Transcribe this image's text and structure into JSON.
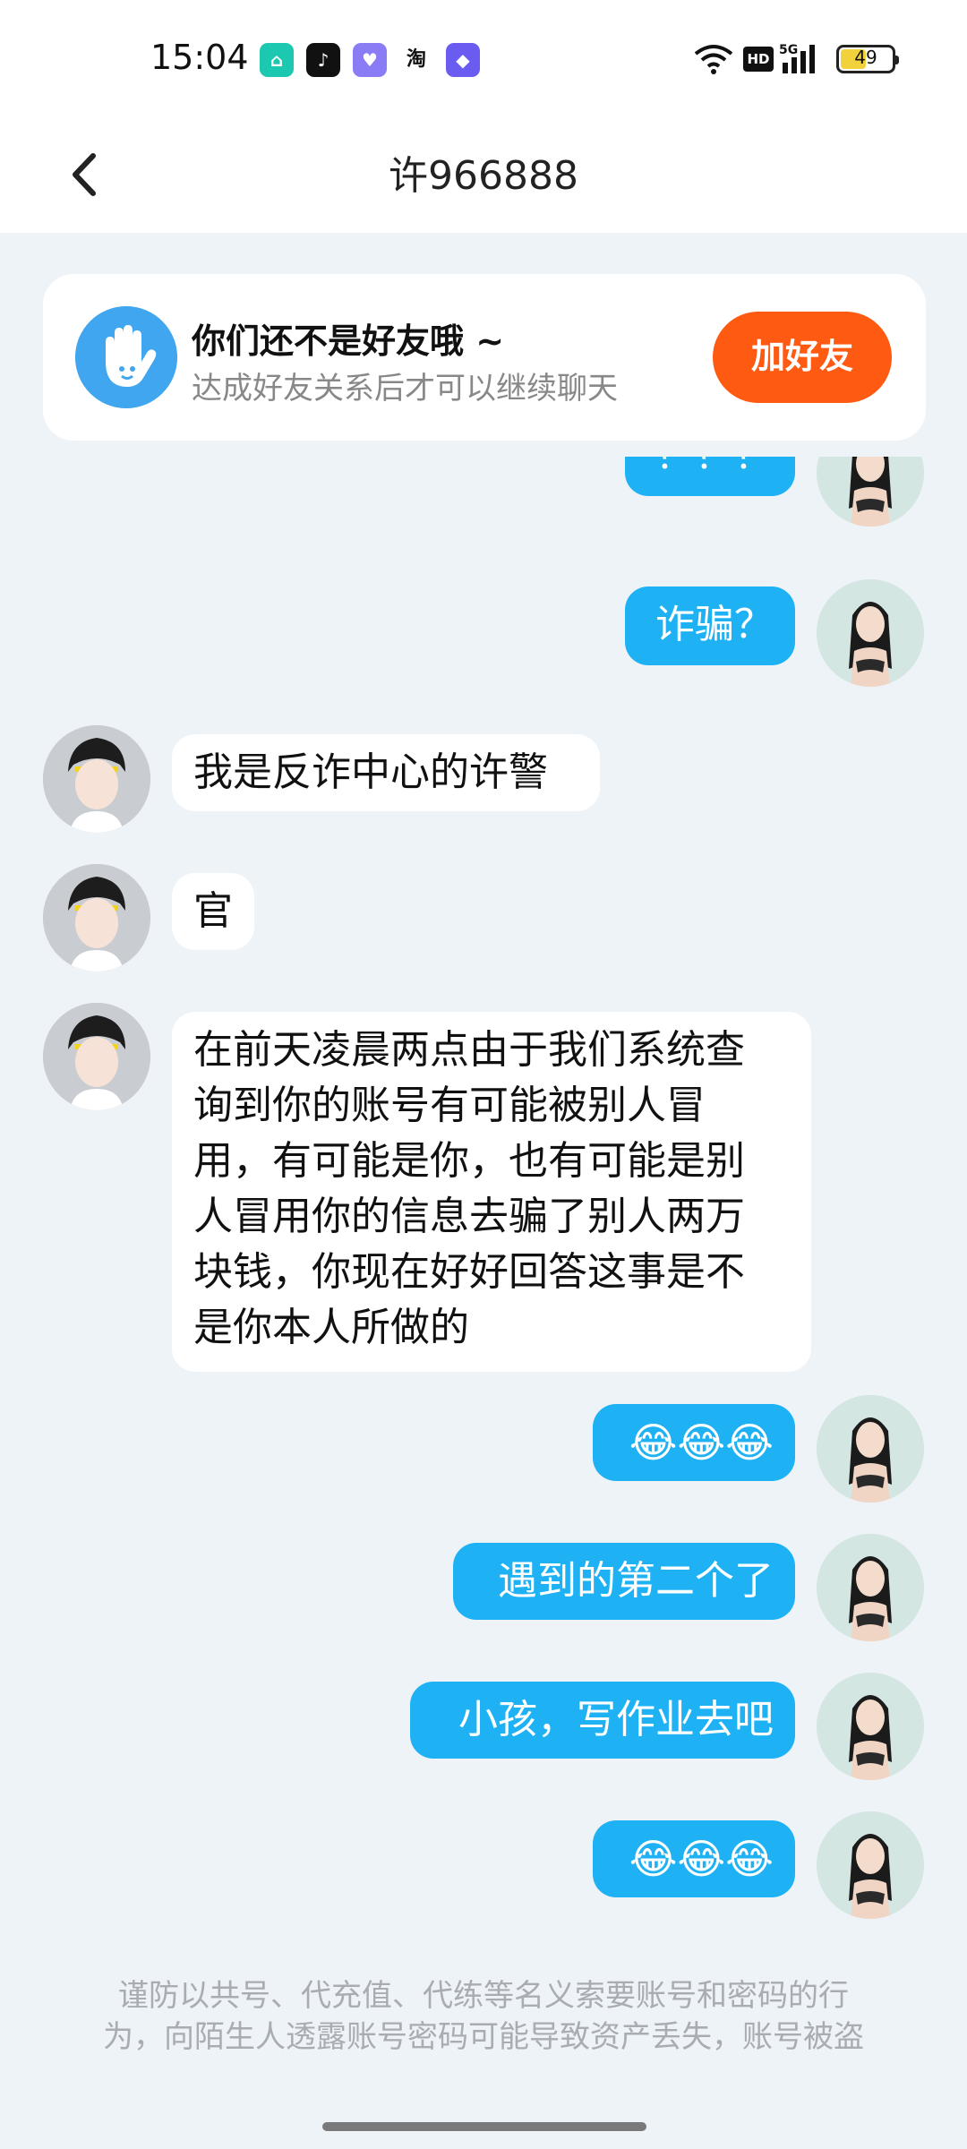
{
  "status_bar": {
    "time": "15:04",
    "battery": "49",
    "network": "5G",
    "hd": "HD",
    "app_icons": [
      "home-app-icon",
      "tiktok-icon",
      "heart-app-icon",
      "taobao-icon",
      "shortcut-app-icon"
    ],
    "taobao_label": "淘"
  },
  "header": {
    "title": "许966888"
  },
  "friend_card": {
    "title": "你们还不是好友哦 ~",
    "subtitle": "达成好友关系后才可以继续聊天",
    "button_label": "加好友"
  },
  "messages": [
    {
      "sender": "me",
      "text": "？？？"
    },
    {
      "sender": "me",
      "text": "诈骗？"
    },
    {
      "sender": "other",
      "text": "我是反诈中心的许警"
    },
    {
      "sender": "other",
      "text": "官"
    },
    {
      "sender": "other",
      "text": "在前天凌晨两点由于我们系统查询到你的账号有可能被别人冒用，有可能是你，也有可能是别人冒用你的信息去骗了别人两万块钱，你现在好好回答这事是不是你本人所做的"
    },
    {
      "sender": "me",
      "text": "😂😂😂"
    },
    {
      "sender": "me",
      "text": "遇到的第二个了"
    },
    {
      "sender": "me",
      "text": "小孩，写作业去吧"
    },
    {
      "sender": "me",
      "text": "😂😂😂"
    }
  ],
  "long_message_lines": [
    "在前天凌晨两点由于我们系统查",
    "询到你的账号有可能被别人冒",
    "用，有可能是你，也有可能是别",
    "人冒用你的信息去骗了别人两万",
    "块钱，你现在好好回答这事是不",
    "是你本人所做的"
  ],
  "warning_lines": [
    "谨防以共号、代充值、代练等名义索要账号和密码的行",
    "为，向陌生人透露账号密码可能导致资产丢失，账号被盗"
  ],
  "colors": {
    "accent_button": "#ff5a12",
    "my_bubble": "#1eb2f5",
    "background": "#eef3f8"
  }
}
